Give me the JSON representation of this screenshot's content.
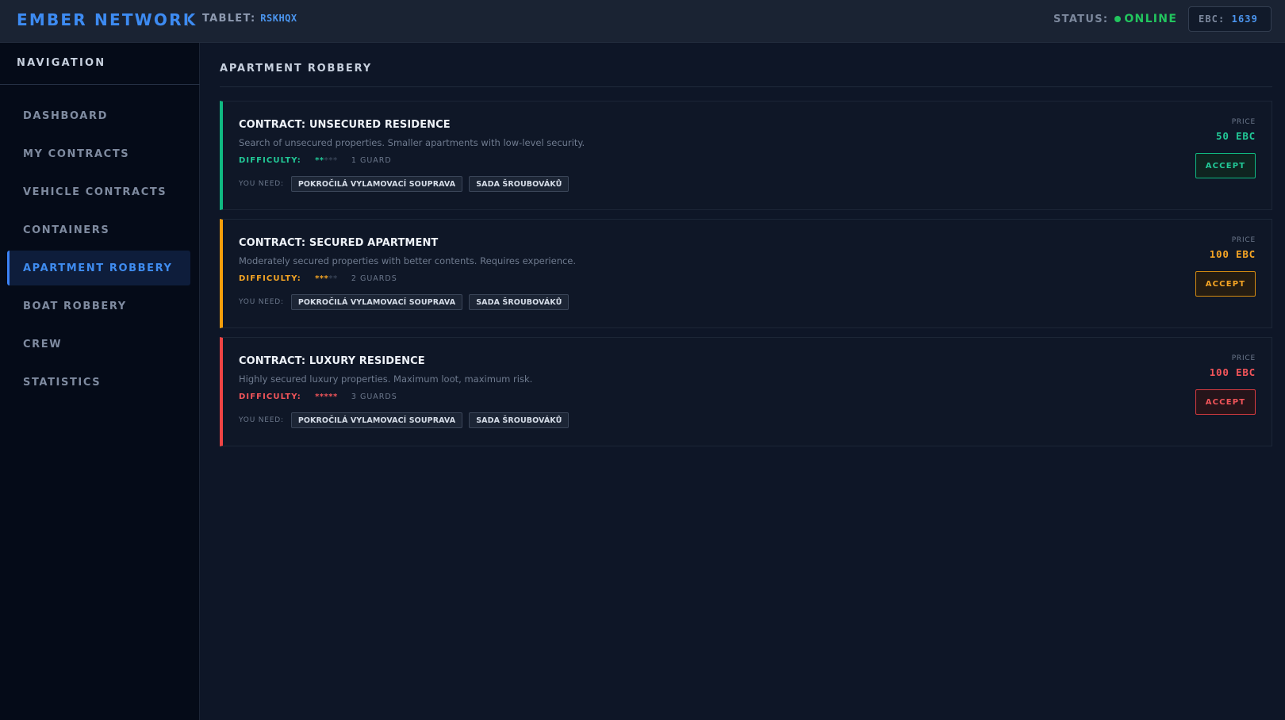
{
  "header": {
    "brand": "EMBER NETWORK",
    "tablet_label": "TABLET:",
    "tablet_id": "RSKHQX",
    "status_label": "STATUS:",
    "status_value": "ONLINE",
    "ebc_label": "EBC:",
    "ebc_value": "1639"
  },
  "sidebar": {
    "title": "NAVIGATION",
    "items": [
      {
        "label": "DASHBOARD"
      },
      {
        "label": "MY CONTRACTS"
      },
      {
        "label": "VEHICLE CONTRACTS"
      },
      {
        "label": "CONTAINERS"
      },
      {
        "label": "APARTMENT ROBBERY",
        "active": true
      },
      {
        "label": "BOAT ROBBERY"
      },
      {
        "label": "CREW"
      },
      {
        "label": "STATISTICS"
      }
    ]
  },
  "main": {
    "section_title": "APARTMENT ROBBERY",
    "contracts": [
      {
        "title": "CONTRACT: UNSECURED RESIDENCE",
        "description": "Search of unsecured properties. Smaller apartments with low-level security.",
        "difficulty_label": "DIFFICULTY:",
        "stars_on": "**",
        "stars_off": "***",
        "difficulty_level": 2,
        "guards": "1 GUARD",
        "need_label": "YOU NEED:",
        "requirements": [
          "POKROČILÁ VYLAMOVACÍ SOUPRAVA",
          "SADA ŠROUBOVÁKŮ"
        ],
        "price_label": "PRICE",
        "price": "50 EBC",
        "accept_label": "ACCEPT",
        "color": "#10b981"
      },
      {
        "title": "CONTRACT: SECURED APARTMENT",
        "description": "Moderately secured properties with better contents. Requires experience.",
        "difficulty_label": "DIFFICULTY:",
        "stars_on": "***",
        "stars_off": "**",
        "difficulty_level": 3,
        "guards": "2 GUARDS",
        "need_label": "YOU NEED:",
        "requirements": [
          "POKROČILÁ VYLAMOVACÍ SOUPRAVA",
          "SADA ŠROUBOVÁKŮ"
        ],
        "price_label": "PRICE",
        "price": "100 EBC",
        "accept_label": "ACCEPT",
        "color": "#f59e0b"
      },
      {
        "title": "CONTRACT: LUXURY RESIDENCE",
        "description": "Highly secured luxury properties. Maximum loot, maximum risk.",
        "difficulty_label": "DIFFICULTY:",
        "stars_on": "*****",
        "stars_off": "",
        "difficulty_level": 5,
        "guards": "3 GUARDS",
        "need_label": "YOU NEED:",
        "requirements": [
          "POKROČILÁ VYLAMOVACÍ SOUPRAVA",
          "SADA ŠROUBOVÁKŮ"
        ],
        "price_label": "PRICE",
        "price": "100 EBC",
        "accept_label": "ACCEPT",
        "color": "#ef4444"
      }
    ]
  },
  "icons": {
    "status_indicator": "status-dot-icon"
  }
}
